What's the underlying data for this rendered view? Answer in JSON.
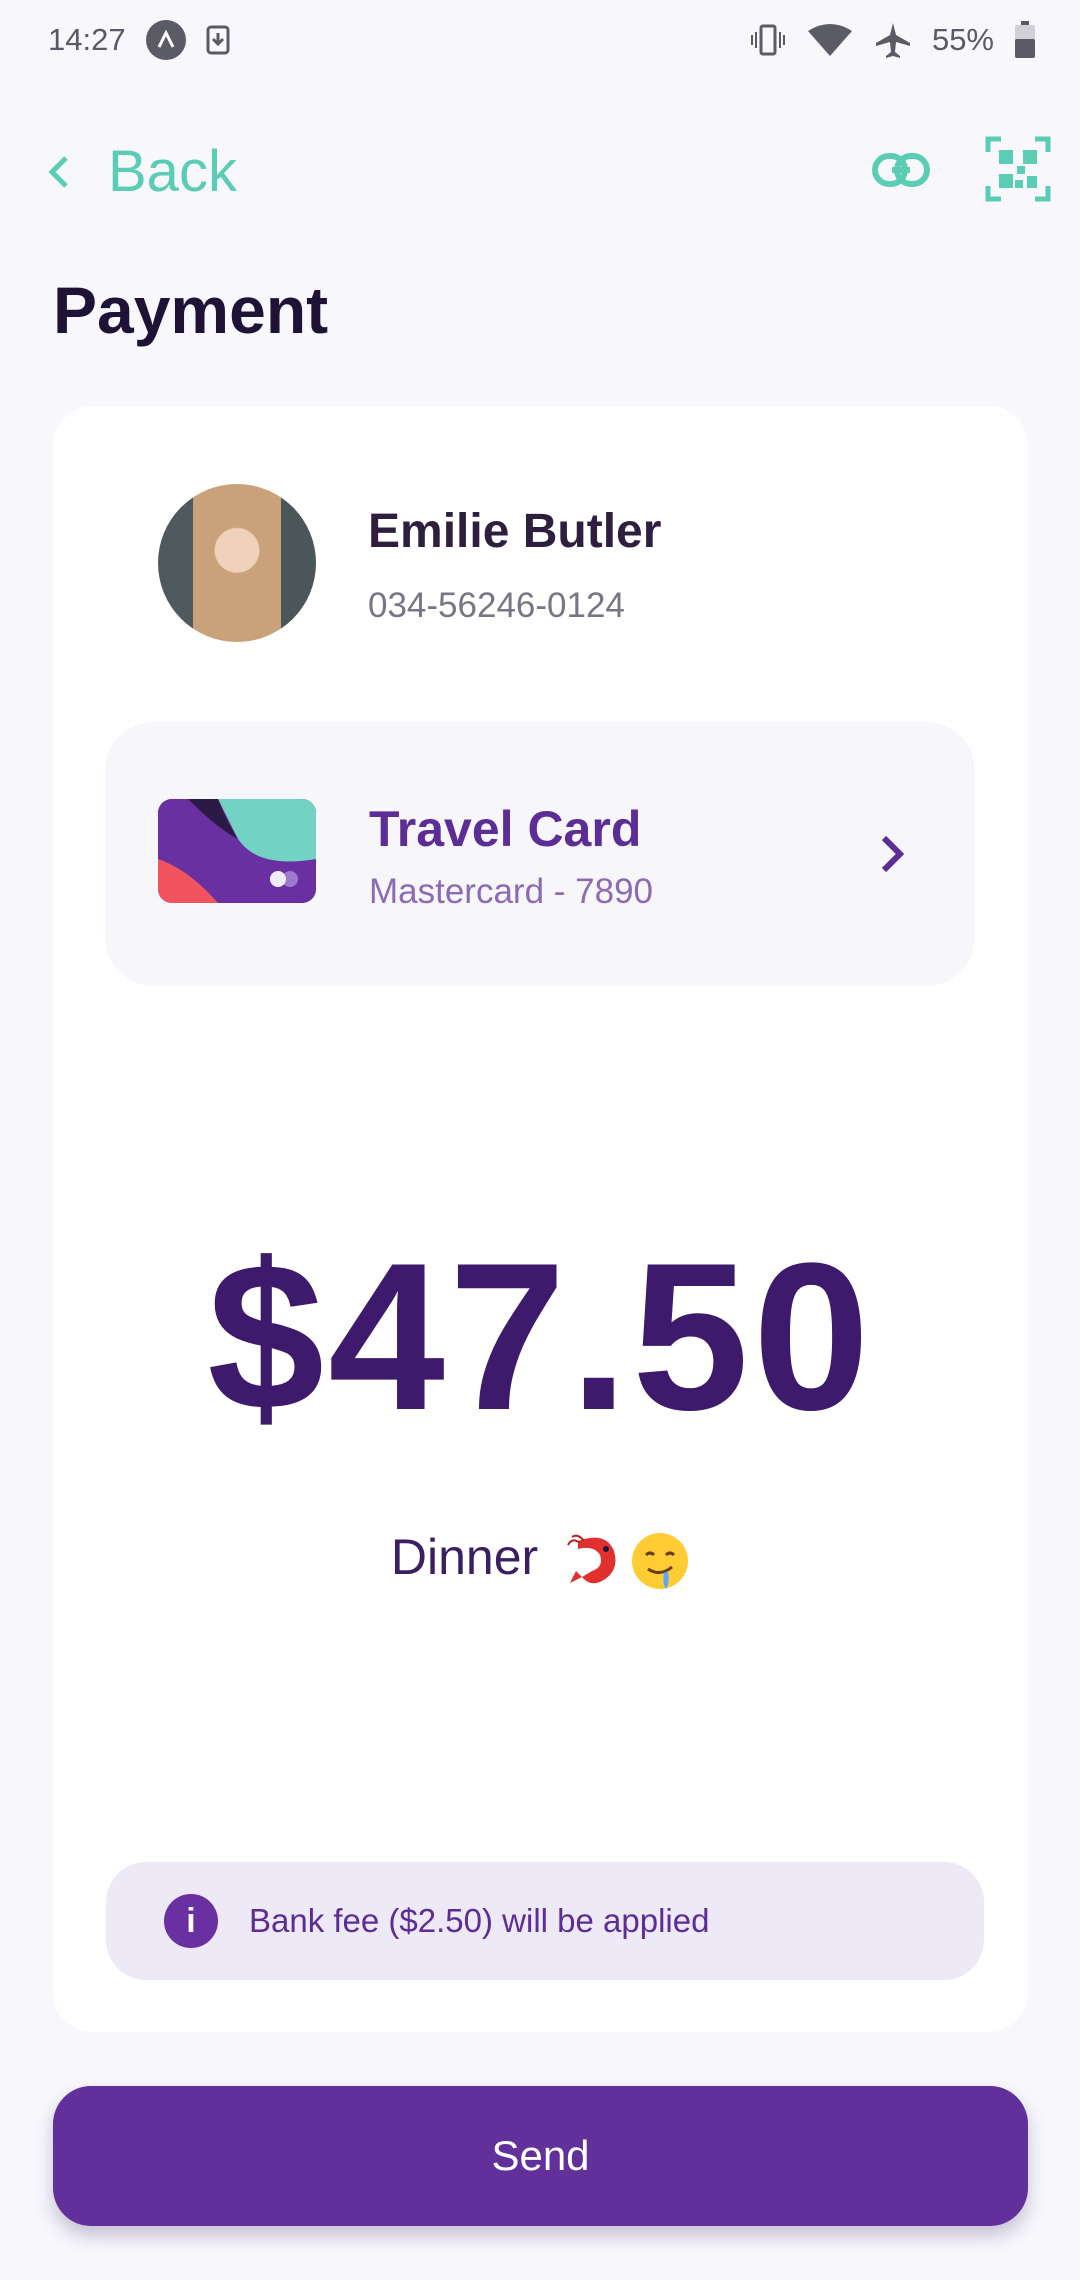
{
  "status_bar": {
    "time": "14:27",
    "battery": "55%",
    "icons": [
      "app-notification-icon",
      "download-icon",
      "vibrate-icon",
      "wifi-icon",
      "airplane-icon",
      "battery-icon"
    ]
  },
  "header": {
    "back_label": "Back",
    "icons": [
      "chevron-left-icon",
      "link-icon",
      "qr-code-icon"
    ],
    "accent": "#5bcdb4"
  },
  "page": {
    "title": "Payment"
  },
  "recipient": {
    "name": "Emilie Butler",
    "phone": "034-56246-0124"
  },
  "payment_method": {
    "name": "Travel Card",
    "detail": "Mastercard - 7890"
  },
  "transfer": {
    "amount": "$47.50",
    "note": "Dinner",
    "note_emojis": [
      "shrimp-emoji",
      "drooling-face-emoji"
    ]
  },
  "fee_notice": {
    "text": "Bank fee ($2.50) will be applied"
  },
  "actions": {
    "send_label": "Send"
  },
  "colors": {
    "primary": "#62309b",
    "amount": "#3d1a6b",
    "background": "#f7f7fc"
  }
}
